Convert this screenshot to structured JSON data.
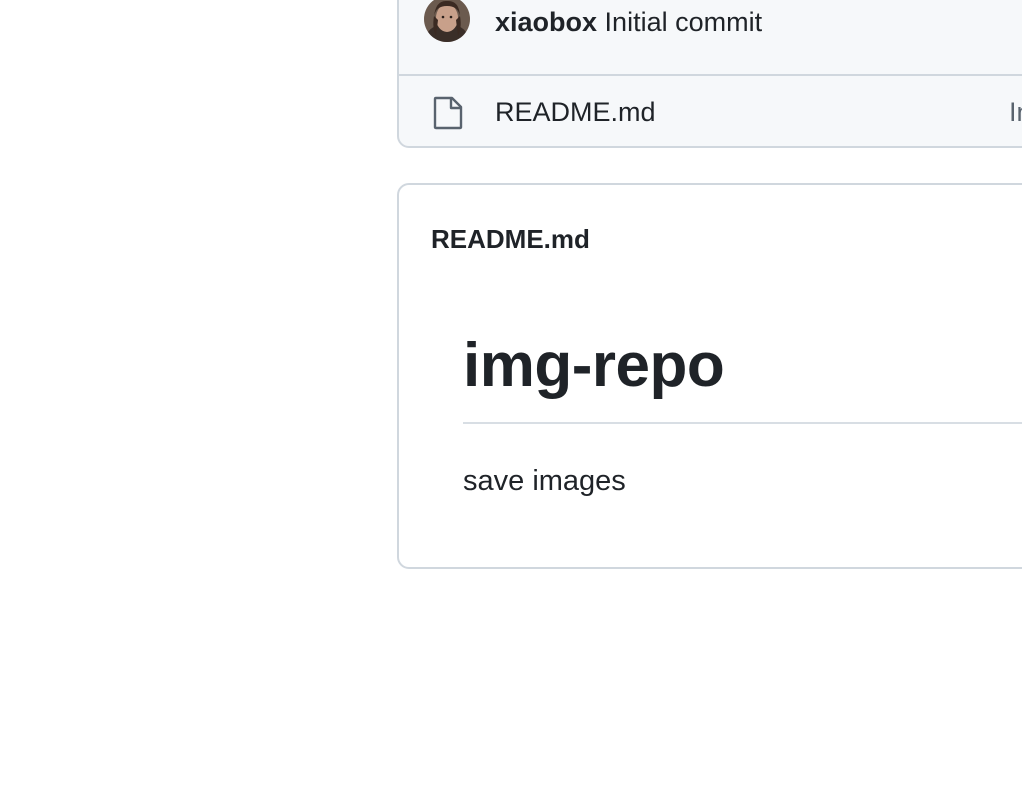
{
  "commit": {
    "author": "xiaobox",
    "message": "Initial commit"
  },
  "files": [
    {
      "name": "README.md",
      "icon": "file-icon",
      "last_commit": "Initial commit"
    }
  ],
  "readme": {
    "header": "README.md",
    "title": "img-repo",
    "body": "save images"
  },
  "colors": {
    "border": "#d0d7de",
    "row_background": "#f6f8fa",
    "text": "#1f2328",
    "muted_text": "#59636e"
  }
}
